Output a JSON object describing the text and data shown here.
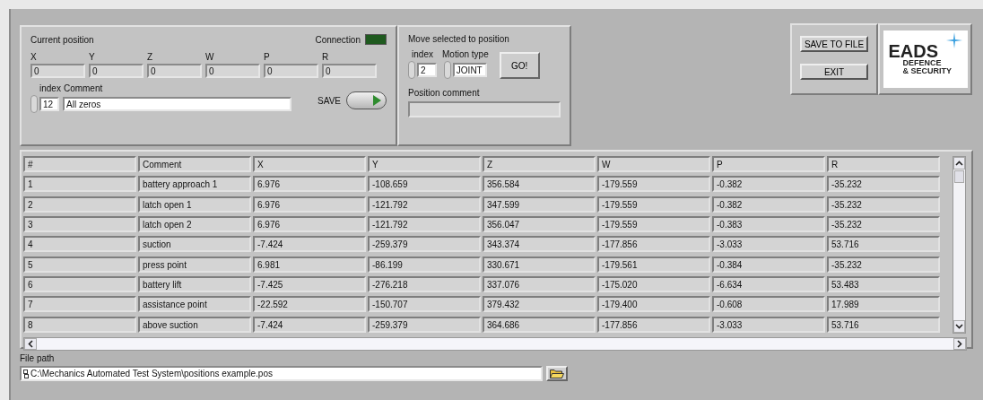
{
  "current_position": {
    "title": "Current position",
    "connection": {
      "label": "Connection",
      "on": false
    },
    "fields": [
      {
        "label": "X",
        "value": "0"
      },
      {
        "label": "Y",
        "value": "0"
      },
      {
        "label": "Z",
        "value": "0"
      },
      {
        "label": "W",
        "value": "0"
      },
      {
        "label": "P",
        "value": "0"
      },
      {
        "label": "R",
        "value": "0"
      }
    ],
    "index": {
      "label": "index",
      "value": "12"
    },
    "comment": {
      "label": "Comment",
      "value": "All zeros"
    },
    "save": {
      "label": "SAVE",
      "on": true
    }
  },
  "move_panel": {
    "title": "Move selected to position",
    "index": {
      "label": "index",
      "value": "2"
    },
    "motion_type": {
      "label": "Motion type",
      "value": "JOINT"
    },
    "go_button": "GO!",
    "position_comment": {
      "label": "Position comment"
    }
  },
  "buttons": [
    "SAVE TO FILE",
    "EXIT"
  ],
  "logo": {
    "name": "EADS",
    "lines": [
      "DEFENCE",
      "& SECURITY"
    ]
  },
  "table": {
    "columns": [
      "#",
      "Comment",
      "X",
      "Y",
      "Z",
      "W",
      "P",
      "R"
    ],
    "rows": [
      [
        "1",
        "battery approach 1",
        "6.976",
        "-108.659",
        "356.584",
        "-179.559",
        "-0.382",
        "-35.232"
      ],
      [
        "2",
        "latch open 1",
        "6.976",
        "-121.792",
        "347.599",
        "-179.559",
        "-0.382",
        "-35.232"
      ],
      [
        "3",
        "latch open 2",
        "6.976",
        "-121.792",
        "356.047",
        "-179.559",
        "-0.383",
        "-35.232"
      ],
      [
        "4",
        "suction",
        "-7.424",
        "-259.379",
        "343.374",
        "-177.856",
        "-3.033",
        "53.716"
      ],
      [
        "5",
        "press point",
        "6.981",
        "-86.199",
        "330.671",
        "-179.561",
        "-0.384",
        "-35.232"
      ],
      [
        "6",
        "battery lift",
        "-7.425",
        "-276.218",
        "337.076",
        "-175.020",
        "-6.634",
        "53.483"
      ],
      [
        "7",
        "assistance point",
        "-22.592",
        "-150.707",
        "379.432",
        "-179.400",
        "-0.608",
        "17.989"
      ],
      [
        "8",
        "above suction",
        "-7.424",
        "-259.379",
        "364.686",
        "-177.856",
        "-3.033",
        "53.716"
      ]
    ]
  },
  "file_path": {
    "label": "File path",
    "value": "C:\\Mechanics Automated Test System\\positions example.pos"
  }
}
